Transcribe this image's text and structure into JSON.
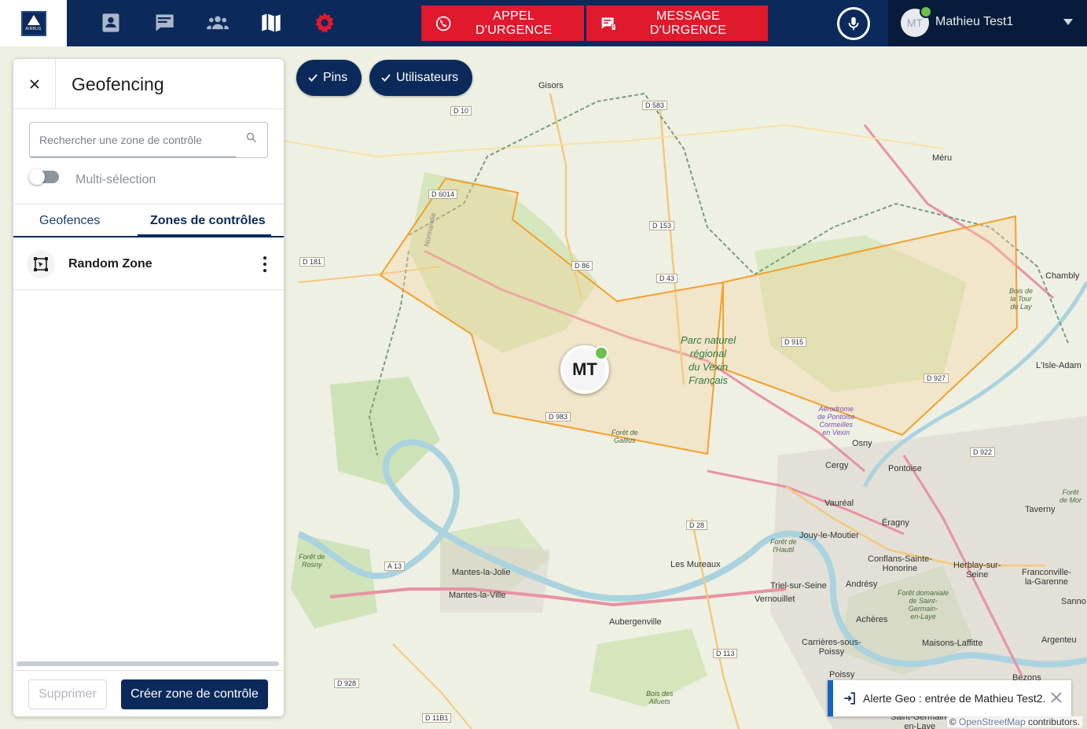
{
  "topbar": {
    "logo_text": "AIRBUS",
    "nav_icons": [
      "contacts-icon",
      "messages-icon",
      "groups-icon",
      "map-icon",
      "settings-icon"
    ],
    "emergency_call_label": "APPEL D'URGENCE",
    "emergency_message_label": "MESSAGE D'URGENCE",
    "user_initials": "MT",
    "user_name": "Mathieu Test1",
    "accent_red": "#e0192d",
    "brand_navy": "#0b2a5b",
    "status_green": "#6cc24a"
  },
  "map": {
    "chips": [
      {
        "label": "Pins",
        "checked": true
      },
      {
        "label": "Utilisateurs",
        "checked": true
      }
    ],
    "marker": {
      "initials": "MT",
      "status": "online"
    },
    "labels": {
      "gisors": "Gisors",
      "meru": "Méru",
      "chambly": "Chambly",
      "isle_adam": "L'Isle-Adam",
      "osny": "Osny",
      "pontoise": "Pontoise",
      "cergy": "Cergy",
      "vaureal": "Vauréal",
      "eragny": "Éragny",
      "taverny": "Taverny",
      "jouy": "Jouy-le-Moutier",
      "conflans": "Conflans-Sainte-\nHonorine",
      "herblay": "Herblay-sur-\nSeine",
      "franconville": "Franconville-\nla-Garenne",
      "les_mureaux": "Les Mureaux",
      "triel": "Triel-sur-Seine",
      "andresy": "Andrésy",
      "verneuil": "Vernouillet",
      "mantes_jolie": "Mantes-la-Jolie",
      "mantes_ville": "Mantes-la-Ville",
      "aubergenville": "Aubergenville",
      "acheres": "Achères",
      "carrieres": "Carrières-sous-\nPoissy",
      "maisons": "Maisons-Laffitte",
      "poissy": "Poissy",
      "argenteuil": "Argenteu",
      "sannois": "Sanno",
      "bezons": "Bezons",
      "saint_germain": "Saint-Germain-\nen-Laye",
      "park": "Parc naturel\nrégional\ndu Vexin\nFrançais",
      "aerodrome": "Aérodrome\nde Pontoise\nCormeilles\nen Vexin",
      "foret_gallius": "Forêt de\nGallius",
      "foret_rosny": "Forêt de\nRosny",
      "foret_hautil": "Forêt de\nl'Hautil",
      "foret_stgermain": "Forêt domaniale\nde Saint-\nGermain-\nen-Laye",
      "bois_alluets": "Bois des\nAlluets",
      "bois_tour": "Bois de\nla Tour\ndu Lay",
      "foret_mor": "Forêt\nde Mor",
      "normandie": "Normandie",
      "d10": "D 10",
      "d583": "D 583",
      "d6014": "D 6014",
      "d153": "D 153",
      "d181": "D 181",
      "d86": "D 86",
      "d43": "D 43",
      "d915": "D 915",
      "d927": "D 927",
      "d983": "D 983",
      "d922": "D 922",
      "d28": "D 28",
      "a13": "A 13",
      "d113": "D 113",
      "d928": "D 928",
      "d11b1": "D 11B1"
    },
    "toast": "Alerte Geo : entrée de Mathieu Test2.",
    "attribution_prefix": "© ",
    "attribution_link": "OpenStreetMap",
    "attribution_suffix": " contributors.",
    "zone_color": "#f5a02a"
  },
  "panel": {
    "title": "Geofencing",
    "search_placeholder": "Rechercher une zone de contrôle",
    "multiselect_label": "Multi-sélection",
    "multiselect_on": false,
    "tabs": [
      {
        "label": "Geofences",
        "active": false
      },
      {
        "label": "Zones de contrôles",
        "active": true
      }
    ],
    "zones": [
      {
        "name": "Random Zone"
      }
    ],
    "delete_label": "Supprimer",
    "create_label": "Créer zone de contrôle"
  }
}
